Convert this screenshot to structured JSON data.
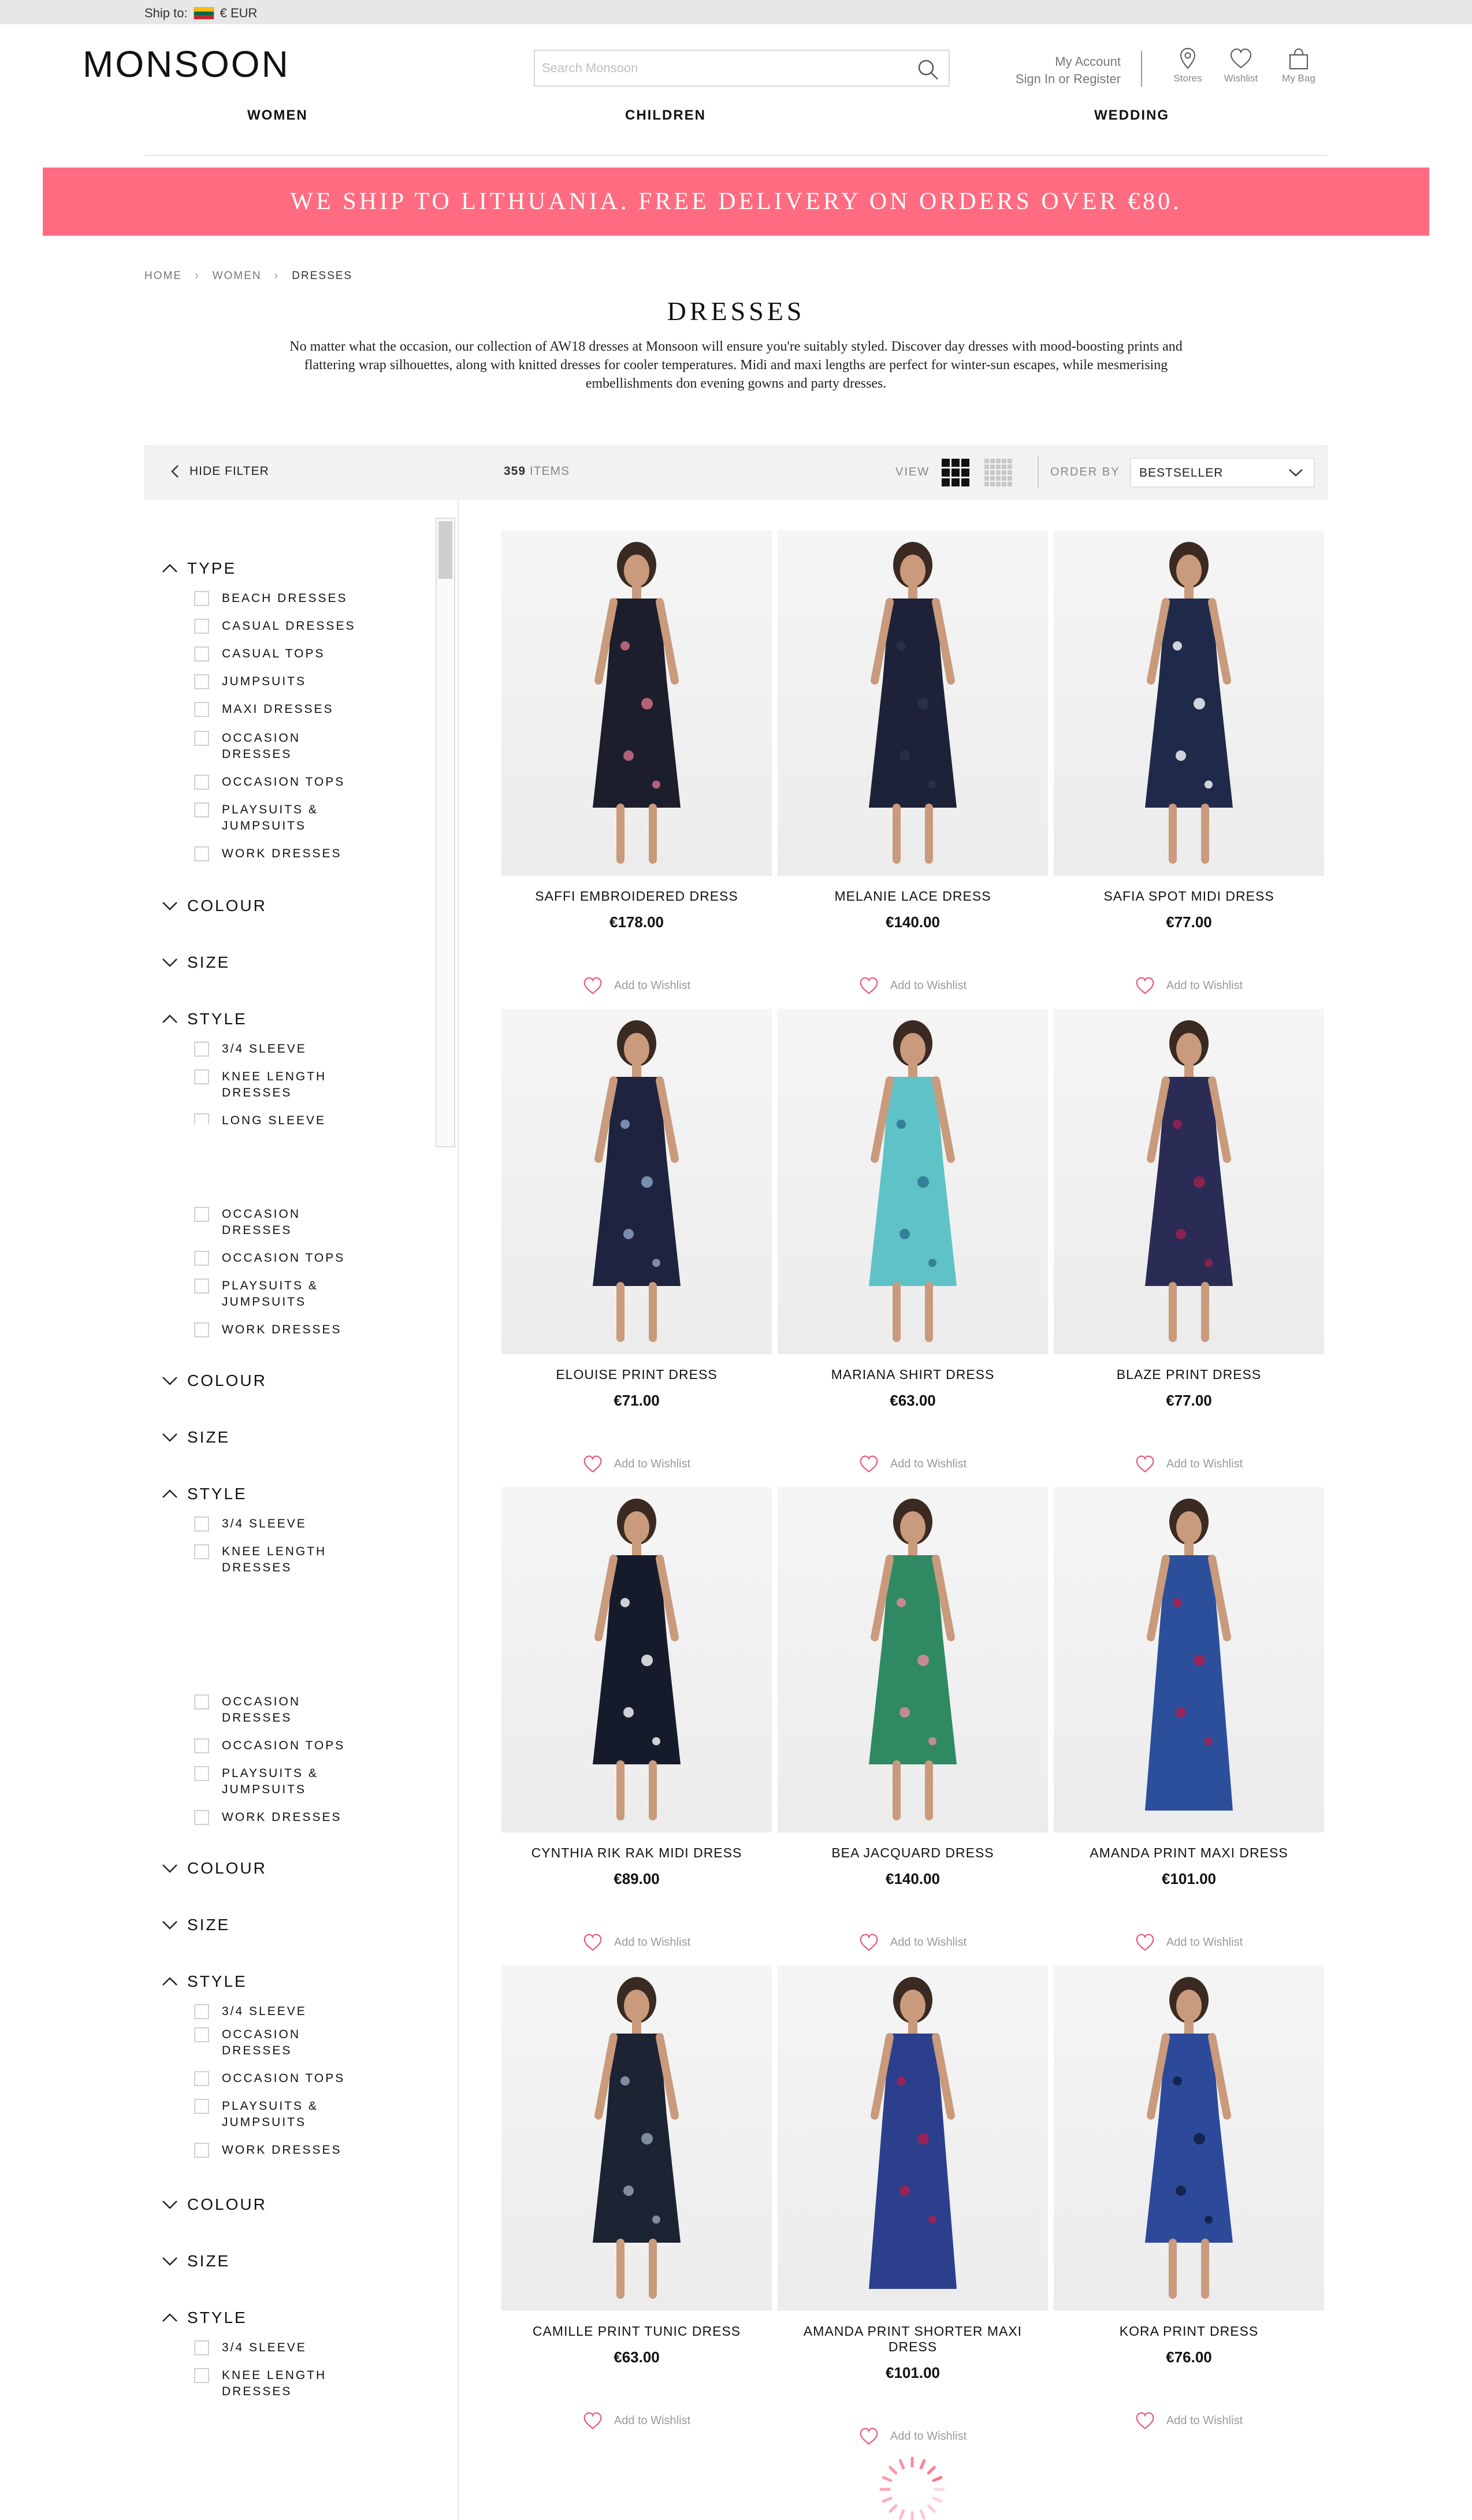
{
  "ship": {
    "label": "Ship to:",
    "currency": "€ EUR",
    "flag_colors": [
      "#fdb913",
      "#006a44",
      "#c1272d"
    ]
  },
  "header": {
    "logo": "MONSOON",
    "search_placeholder": "Search Monsoon",
    "account_title": "My Account",
    "account_sub": "Sign In or Register",
    "stores": "Stores",
    "wishlist": "Wishlist",
    "bag": "My Bag"
  },
  "nav": {
    "women": "WOMEN",
    "children": "CHILDREN",
    "wedding": "WEDDING"
  },
  "promo": {
    "text": "WE SHIP TO LITHUANIA. FREE DELIVERY ON ORDERS OVER €80.",
    "color": "#ff6b81"
  },
  "breadcrumb": [
    "HOME",
    "WOMEN",
    "DRESSES"
  ],
  "page": {
    "title": "DRESSES",
    "intro": "No matter what the occasion, our collection of AW18 dresses at Monsoon will ensure you're suitably styled. Discover day dresses with mood-boosting prints and flattering wrap silhouettes, along with knitted dresses for cooler temperatures. Midi and maxi lengths are perfect for winter-sun escapes, while mesmerising embellishments don evening gowns and party dresses."
  },
  "toolbar": {
    "hide_filter": "HIDE FILTER",
    "count": "359",
    "count_suffix": "ITEMS",
    "view_label": "VIEW",
    "order_label": "ORDER BY",
    "order_value": "BESTSELLER"
  },
  "filters": {
    "type": "TYPE",
    "colour": "COLOUR",
    "size": "SIZE",
    "style": "STYLE",
    "type_options": [
      "BEACH DRESSES",
      "CASUAL DRESSES",
      "CASUAL TOPS",
      "JUMPSUITS",
      "MAXI DRESSES",
      "OCCASION DRESSES",
      "OCCASION TOPS",
      "PLAYSUITS & JUMPSUITS",
      "WORK DRESSES"
    ],
    "style_options": [
      "3/4 SLEEVE",
      "KNEE LENGTH DRESSES",
      "LONG SLEEVE"
    ],
    "repeat_options": [
      "OCCASION DRESSES",
      "OCCASION TOPS",
      "PLAYSUITS & JUMPSUITS",
      "WORK DRESSES"
    ]
  },
  "wishlist_label": "Add to Wishlist",
  "products": [
    {
      "name": "SAFFI EMBROIDERED DRESS",
      "price": "€178.00",
      "dress": "#1c1e2b",
      "accent": "#d9738a"
    },
    {
      "name": "MELANIE LACE DRESS",
      "price": "€140.00",
      "dress": "#1d2238",
      "accent": "#2d3350"
    },
    {
      "name": "SAFIA SPOT MIDI DRESS",
      "price": "€77.00",
      "dress": "#1f2a4a",
      "accent": "#ffffff"
    },
    {
      "name": "ELOUISE PRINT DRESS",
      "price": "€71.00",
      "dress": "#1e2340",
      "accent": "#8fa7c9"
    },
    {
      "name": "MARIANA SHIRT DRESS",
      "price": "€63.00",
      "dress": "#5fc2c7",
      "accent": "#2b6e8f"
    },
    {
      "name": "BLAZE PRINT DRESS",
      "price": "€77.00",
      "dress": "#2a2c55",
      "accent": "#a0204e"
    },
    {
      "name": "CYNTHIA RIK RAK MIDI DRESS",
      "price": "€89.00",
      "dress": "#161b2c",
      "accent": "#ffffff"
    },
    {
      "name": "BEA JACQUARD DRESS",
      "price": "€140.00",
      "dress": "#2f8a64",
      "accent": "#e68aa0"
    },
    {
      "name": "AMANDA PRINT MAXI DRESS",
      "price": "€101.00",
      "dress": "#2c4f9c",
      "accent": "#b01e4e"
    },
    {
      "name": "CAMILLE PRINT TUNIC DRESS",
      "price": "€63.00",
      "dress": "#1c2333",
      "accent": "#9aa6b8"
    },
    {
      "name": "AMANDA PRINT SHORTER MAXI DRESS",
      "price": "€101.00",
      "dress": "#2b3f8c",
      "accent": "#b01e4e"
    },
    {
      "name": "KORA PRINT DRESS",
      "price": "€76.00",
      "dress": "#2d4a9a",
      "accent": "#0f1c3e"
    }
  ]
}
